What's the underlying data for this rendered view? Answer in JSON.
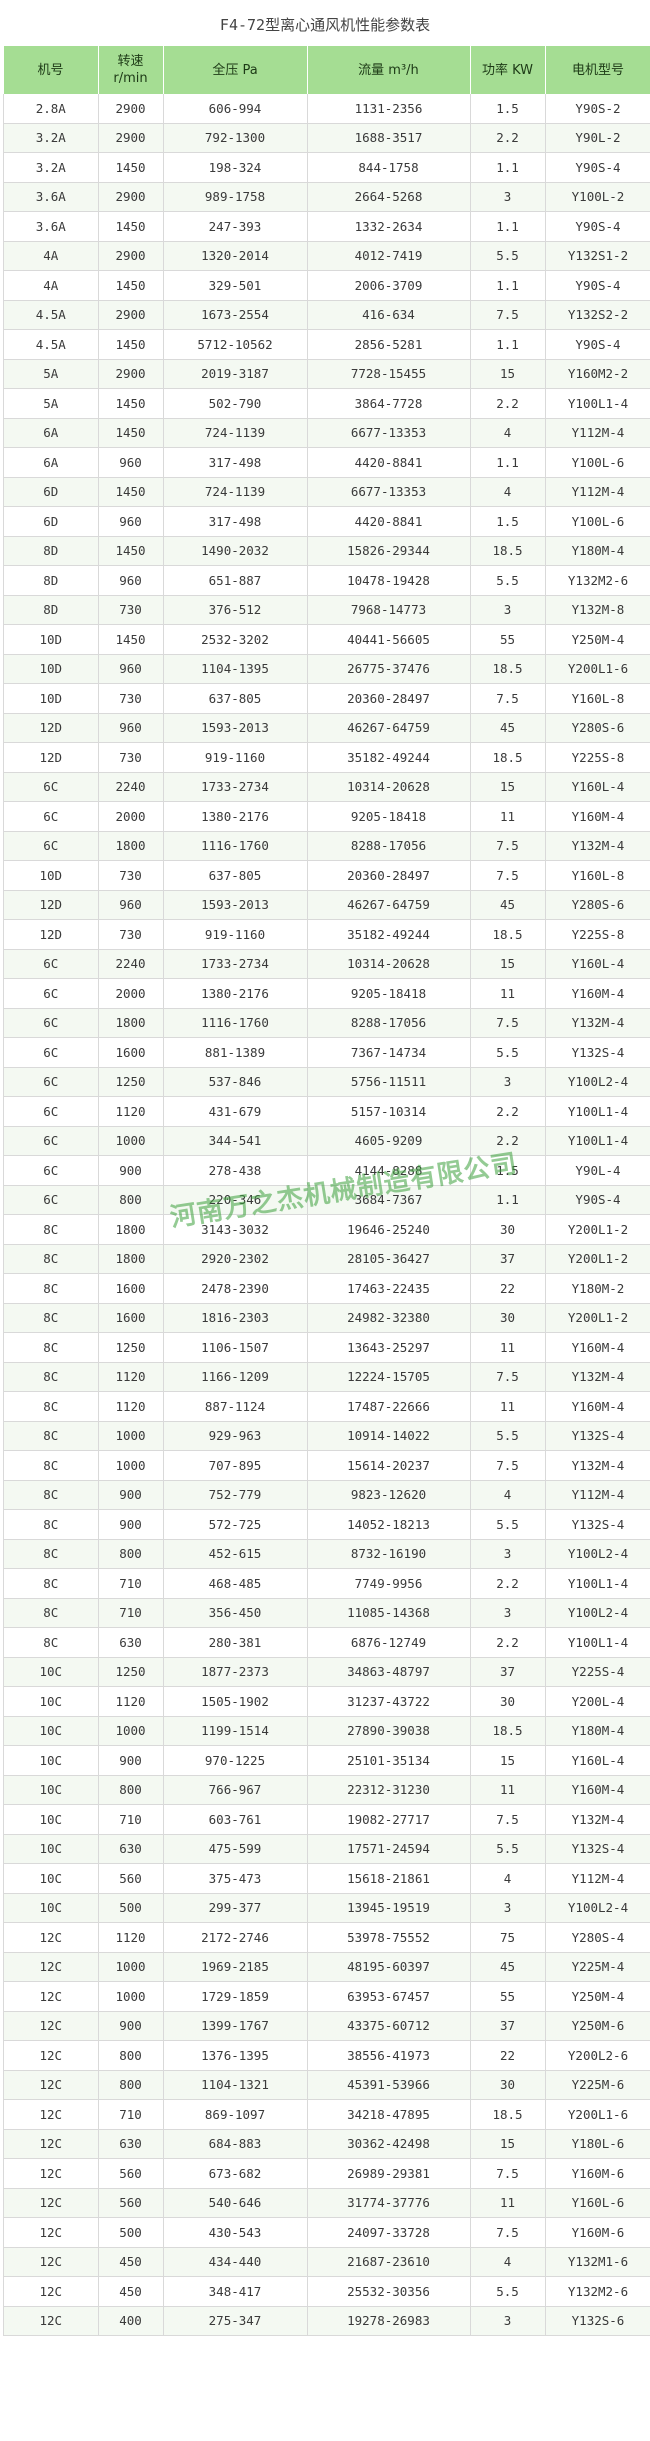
{
  "title": "F4-72型离心通风机性能参数表",
  "headers": {
    "model": "机号",
    "speed": "转速",
    "speed_unit": "r/min",
    "pressure": "全压 Pa",
    "flow": "流量 m³/h",
    "power": "功率 KW",
    "motor": "电机型号"
  },
  "watermark": "河南万之杰机械制造有限公司",
  "colors": {
    "header_bg": "#a5dd93",
    "grid": "#d9d9d9",
    "watermark": "#3ca03c"
  },
  "rows": [
    [
      "2.8A",
      "2900",
      "606-994",
      "1131-2356",
      "1.5",
      "Y90S-2"
    ],
    [
      "3.2A",
      "2900",
      "792-1300",
      "1688-3517",
      "2.2",
      "Y90L-2"
    ],
    [
      "3.2A",
      "1450",
      "198-324",
      "844-1758",
      "1.1",
      "Y90S-4"
    ],
    [
      "3.6A",
      "2900",
      "989-1758",
      "2664-5268",
      "3",
      "Y100L-2"
    ],
    [
      "3.6A",
      "1450",
      "247-393",
      "1332-2634",
      "1.1",
      "Y90S-4"
    ],
    [
      "4A",
      "2900",
      "1320-2014",
      "4012-7419",
      "5.5",
      "Y132S1-2"
    ],
    [
      "4A",
      "1450",
      "329-501",
      "2006-3709",
      "1.1",
      "Y90S-4"
    ],
    [
      "4.5A",
      "2900",
      "1673-2554",
      "416-634",
      "7.5",
      "Y132S2-2"
    ],
    [
      "4.5A",
      "1450",
      "5712-10562",
      "2856-5281",
      "1.1",
      "Y90S-4"
    ],
    [
      "5A",
      "2900",
      "2019-3187",
      "7728-15455",
      "15",
      "Y160M2-2"
    ],
    [
      "5A",
      "1450",
      "502-790",
      "3864-7728",
      "2.2",
      "Y100L1-4"
    ],
    [
      "6A",
      "1450",
      "724-1139",
      "6677-13353",
      "4",
      "Y112M-4"
    ],
    [
      "6A",
      "960",
      "317-498",
      "4420-8841",
      "1.1",
      "Y100L-6"
    ],
    [
      "6D",
      "1450",
      "724-1139",
      "6677-13353",
      "4",
      "Y112M-4"
    ],
    [
      "6D",
      "960",
      "317-498",
      "4420-8841",
      "1.5",
      "Y100L-6"
    ],
    [
      "8D",
      "1450",
      "1490-2032",
      "15826-29344",
      "18.5",
      "Y180M-4"
    ],
    [
      "8D",
      "960",
      "651-887",
      "10478-19428",
      "5.5",
      "Y132M2-6"
    ],
    [
      "8D",
      "730",
      "376-512",
      "7968-14773",
      "3",
      "Y132M-8"
    ],
    [
      "10D",
      "1450",
      "2532-3202",
      "40441-56605",
      "55",
      "Y250M-4"
    ],
    [
      "10D",
      "960",
      "1104-1395",
      "26775-37476",
      "18.5",
      "Y200L1-6"
    ],
    [
      "10D",
      "730",
      "637-805",
      "20360-28497",
      "7.5",
      "Y160L-8"
    ],
    [
      "12D",
      "960",
      "1593-2013",
      "46267-64759",
      "45",
      "Y280S-6"
    ],
    [
      "12D",
      "730",
      "919-1160",
      "35182-49244",
      "18.5",
      "Y225S-8"
    ],
    [
      "6C",
      "2240",
      "1733-2734",
      "10314-20628",
      "15",
      "Y160L-4"
    ],
    [
      "6C",
      "2000",
      "1380-2176",
      "9205-18418",
      "11",
      "Y160M-4"
    ],
    [
      "6C",
      "1800",
      "1116-1760",
      "8288-17056",
      "7.5",
      "Y132M-4"
    ],
    [
      "10D",
      "730",
      "637-805",
      "20360-28497",
      "7.5",
      "Y160L-8"
    ],
    [
      "12D",
      "960",
      "1593-2013",
      "46267-64759",
      "45",
      "Y280S-6"
    ],
    [
      "12D",
      "730",
      "919-1160",
      "35182-49244",
      "18.5",
      "Y225S-8"
    ],
    [
      "6C",
      "2240",
      "1733-2734",
      "10314-20628",
      "15",
      "Y160L-4"
    ],
    [
      "6C",
      "2000",
      "1380-2176",
      "9205-18418",
      "11",
      "Y160M-4"
    ],
    [
      "6C",
      "1800",
      "1116-1760",
      "8288-17056",
      "7.5",
      "Y132M-4"
    ],
    [
      "6C",
      "1600",
      "881-1389",
      "7367-14734",
      "5.5",
      "Y132S-4"
    ],
    [
      "6C",
      "1250",
      "537-846",
      "5756-11511",
      "3",
      "Y100L2-4"
    ],
    [
      "6C",
      "1120",
      "431-679",
      "5157-10314",
      "2.2",
      "Y100L1-4"
    ],
    [
      "6C",
      "1000",
      "344-541",
      "4605-9209",
      "2.2",
      "Y100L1-4"
    ],
    [
      "6C",
      "900",
      "278-438",
      "4144-8288",
      "1.5",
      "Y90L-4"
    ],
    [
      "6C",
      "800",
      "220-346",
      "3684-7367",
      "1.1",
      "Y90S-4"
    ],
    [
      "8C",
      "1800",
      "3143-3032",
      "19646-25240",
      "30",
      "Y200L1-2"
    ],
    [
      "8C",
      "1800",
      "2920-2302",
      "28105-36427",
      "37",
      "Y200L1-2"
    ],
    [
      "8C",
      "1600",
      "2478-2390",
      "17463-22435",
      "22",
      "Y180M-2"
    ],
    [
      "8C",
      "1600",
      "1816-2303",
      "24982-32380",
      "30",
      "Y200L1-2"
    ],
    [
      "8C",
      "1250",
      "1106-1507",
      "13643-25297",
      "11",
      "Y160M-4"
    ],
    [
      "8C",
      "1120",
      "1166-1209",
      "12224-15705",
      "7.5",
      "Y132M-4"
    ],
    [
      "8C",
      "1120",
      "887-1124",
      "17487-22666",
      "11",
      "Y160M-4"
    ],
    [
      "8C",
      "1000",
      "929-963",
      "10914-14022",
      "5.5",
      "Y132S-4"
    ],
    [
      "8C",
      "1000",
      "707-895",
      "15614-20237",
      "7.5",
      "Y132M-4"
    ],
    [
      "8C",
      "900",
      "752-779",
      "9823-12620",
      "4",
      "Y112M-4"
    ],
    [
      "8C",
      "900",
      "572-725",
      "14052-18213",
      "5.5",
      "Y132S-4"
    ],
    [
      "8C",
      "800",
      "452-615",
      "8732-16190",
      "3",
      "Y100L2-4"
    ],
    [
      "8C",
      "710",
      "468-485",
      "7749-9956",
      "2.2",
      "Y100L1-4"
    ],
    [
      "8C",
      "710",
      "356-450",
      "11085-14368",
      "3",
      "Y100L2-4"
    ],
    [
      "8C",
      "630",
      "280-381",
      "6876-12749",
      "2.2",
      "Y100L1-4"
    ],
    [
      "10C",
      "1250",
      "1877-2373",
      "34863-48797",
      "37",
      "Y225S-4"
    ],
    [
      "10C",
      "1120",
      "1505-1902",
      "31237-43722",
      "30",
      "Y200L-4"
    ],
    [
      "10C",
      "1000",
      "1199-1514",
      "27890-39038",
      "18.5",
      "Y180M-4"
    ],
    [
      "10C",
      "900",
      "970-1225",
      "25101-35134",
      "15",
      "Y160L-4"
    ],
    [
      "10C",
      "800",
      "766-967",
      "22312-31230",
      "11",
      "Y160M-4"
    ],
    [
      "10C",
      "710",
      "603-761",
      "19082-27717",
      "7.5",
      "Y132M-4"
    ],
    [
      "10C",
      "630",
      "475-599",
      "17571-24594",
      "5.5",
      "Y132S-4"
    ],
    [
      "10C",
      "560",
      "375-473",
      "15618-21861",
      "4",
      "Y112M-4"
    ],
    [
      "10C",
      "500",
      "299-377",
      "13945-19519",
      "3",
      "Y100L2-4"
    ],
    [
      "12C",
      "1120",
      "2172-2746",
      "53978-75552",
      "75",
      "Y280S-4"
    ],
    [
      "12C",
      "1000",
      "1969-2185",
      "48195-60397",
      "45",
      "Y225M-4"
    ],
    [
      "12C",
      "1000",
      "1729-1859",
      "63953-67457",
      "55",
      "Y250M-4"
    ],
    [
      "12C",
      "900",
      "1399-1767",
      "43375-60712",
      "37",
      "Y250M-6"
    ],
    [
      "12C",
      "800",
      "1376-1395",
      "38556-41973",
      "22",
      "Y200L2-6"
    ],
    [
      "12C",
      "800",
      "1104-1321",
      "45391-53966",
      "30",
      "Y225M-6"
    ],
    [
      "12C",
      "710",
      "869-1097",
      "34218-47895",
      "18.5",
      "Y200L1-6"
    ],
    [
      "12C",
      "630",
      "684-883",
      "30362-42498",
      "15",
      "Y180L-6"
    ],
    [
      "12C",
      "560",
      "673-682",
      "26989-29381",
      "7.5",
      "Y160M-6"
    ],
    [
      "12C",
      "560",
      "540-646",
      "31774-37776",
      "11",
      "Y160L-6"
    ],
    [
      "12C",
      "500",
      "430-543",
      "24097-33728",
      "7.5",
      "Y160M-6"
    ],
    [
      "12C",
      "450",
      "434-440",
      "21687-23610",
      "4",
      "Y132M1-6"
    ],
    [
      "12C",
      "450",
      "348-417",
      "25532-30356",
      "5.5",
      "Y132M2-6"
    ],
    [
      "12C",
      "400",
      "275-347",
      "19278-26983",
      "3",
      "Y132S-6"
    ]
  ]
}
